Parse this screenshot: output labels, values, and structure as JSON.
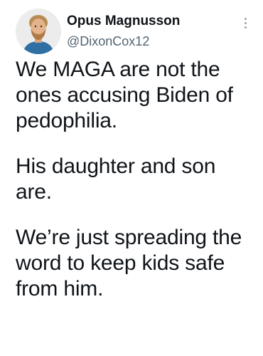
{
  "tweet": {
    "author": {
      "display_name": "Opus Magnusson",
      "handle": "@DixonCox12",
      "avatar": "avatar-photo"
    },
    "more_icon": "more-vertical-icon",
    "paragraphs": [
      "We MAGA are not the ones accusing Biden of pedophilia.",
      "His daughter and son are.",
      "We’re just spreading the word to keep kids safe from him."
    ]
  }
}
